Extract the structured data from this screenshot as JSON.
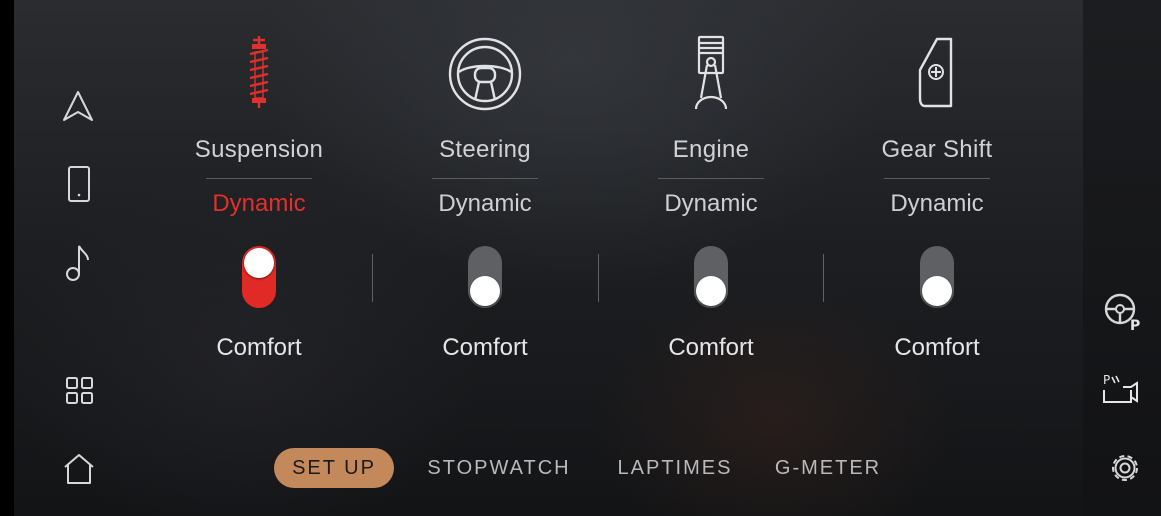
{
  "sidebar": {
    "items": [
      {
        "icon": "navigation-icon"
      },
      {
        "icon": "phone-icon"
      },
      {
        "icon": "music-note-icon"
      },
      {
        "icon": "apps-grid-icon"
      },
      {
        "icon": "home-icon"
      }
    ]
  },
  "rightbar": {
    "items": [
      {
        "icon": "steering-wheel-parking-icon",
        "label": "P"
      },
      {
        "icon": "park-distance-camera-icon",
        "label": "P"
      },
      {
        "icon": "gear-icon"
      }
    ]
  },
  "settings": [
    {
      "title": "Suspension",
      "mode": "Dynamic",
      "comfort": "Comfort",
      "dynamic_active": true,
      "icon": "suspension-spring-icon"
    },
    {
      "title": "Steering",
      "mode": "Dynamic",
      "comfort": "Comfort",
      "dynamic_active": false,
      "icon": "steering-wheel-icon"
    },
    {
      "title": "Engine",
      "mode": "Dynamic",
      "comfort": "Comfort",
      "dynamic_active": false,
      "icon": "engine-piston-icon"
    },
    {
      "title": "Gear Shift",
      "mode": "Dynamic",
      "comfort": "Comfort",
      "dynamic_active": false,
      "icon": "gear-shift-paddle-icon"
    }
  ],
  "tabs": [
    {
      "label": "SET UP",
      "active": true
    },
    {
      "label": "STOPWATCH",
      "active": false
    },
    {
      "label": "LAPTIMES",
      "active": false
    },
    {
      "label": "G-METER",
      "active": false
    }
  ],
  "colors": {
    "accent_red": "#e12a25",
    "tab_active": "#c4895a",
    "toggle_off": "#5f6064"
  }
}
